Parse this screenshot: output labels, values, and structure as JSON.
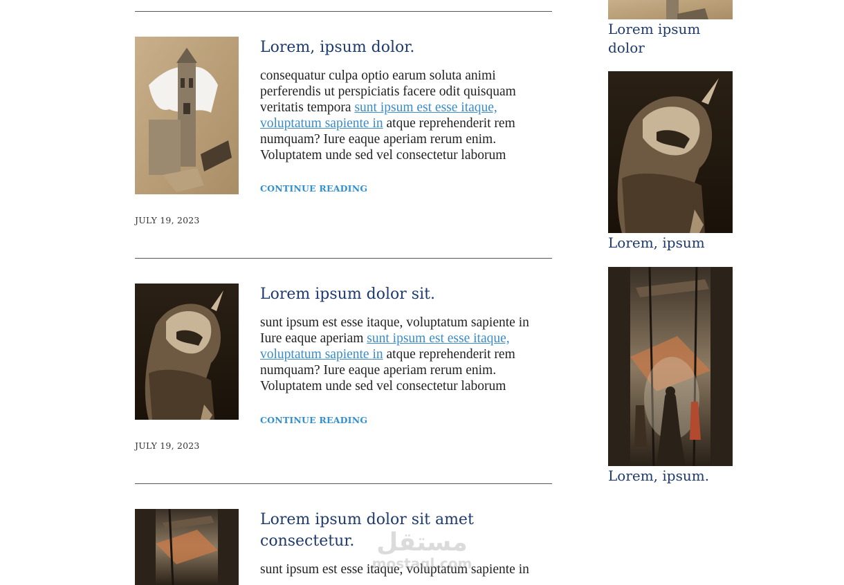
{
  "posts": [
    {
      "title": "Lorem, ipsum dolor.",
      "excerpt_before": "consequatur culpa optio earum soluta animi perferendis ut perspiciatis facere odit quisquam veritatis tempora ",
      "excerpt_link": "sunt ipsum est esse itaque, voluptatum sapiente in",
      "excerpt_after": " atque reprehenderit rem numquam? Iure eaque aperiam rerum enim. Voluptatem unde sed vel consectetur laborum",
      "continue_label": "CONTINUE READING",
      "date": "JULY 19, 2023",
      "image": "tower-sketch"
    },
    {
      "title": "Lorem ipsum dolor sit.",
      "excerpt_before": "sunt ipsum est esse itaque, voluptatum sapiente in Iure eaque aperiam ",
      "excerpt_link": "sunt ipsum est esse itaque, voluptatum sapiente in",
      "excerpt_after": " atque reprehenderit rem numquam? Iure eaque aperiam rerum enim. Voluptatem unde sed vel consectetur laborum",
      "continue_label": "CONTINUE READING",
      "date": "JULY 19, 2023",
      "image": "hooded-figure"
    },
    {
      "title": "Lorem ipsum dolor sit amet consectetur.",
      "excerpt_before": "sunt ipsum est esse itaque, voluptatum sapiente in",
      "image": "market-alley"
    }
  ],
  "sidebar": {
    "items": [
      {
        "title": "Lorem ipsum dolor",
        "image": "tower-sketch"
      },
      {
        "title": "Lorem, ipsum",
        "image": "hooded-figure"
      },
      {
        "title": "Lorem, ipsum.",
        "image": "market-alley"
      }
    ]
  },
  "watermark": {
    "arabic": "مستقل",
    "latin": "mostaql.com"
  },
  "colors": {
    "title": "#1d3a6e",
    "link": "#3a8cc8",
    "continue": "#2f8fd1",
    "body": "#222222",
    "rule": "#555555"
  }
}
